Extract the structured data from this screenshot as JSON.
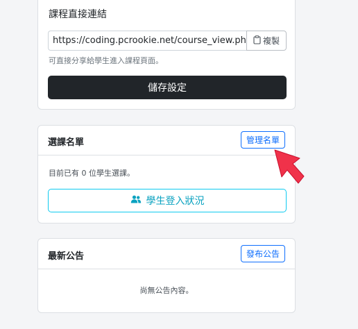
{
  "link_section": {
    "label": "課程直接連結",
    "url_value": "https://coding.pcrookie.net/course_view.php?",
    "copy_label": "複製",
    "help_text": "可直接分享給學生進入課程頁面。",
    "save_label": "儲存設定"
  },
  "roster": {
    "title": "選課名單",
    "manage_label": "管理名單",
    "count_text": "目前已有 0 位學生選課。",
    "login_status_label": "學生登入狀況"
  },
  "announcements": {
    "title": "最新公告",
    "publish_label": "發布公告",
    "empty_text": "尚無公告內容。"
  },
  "colors": {
    "primary": "#0d6efd",
    "info": "#0dcaf0",
    "dark": "#212529",
    "pointer": "#f0324a"
  },
  "icons": {
    "copy": "clipboard-icon",
    "login_status": "users-icon",
    "pointer": "arrow-cursor-icon"
  }
}
